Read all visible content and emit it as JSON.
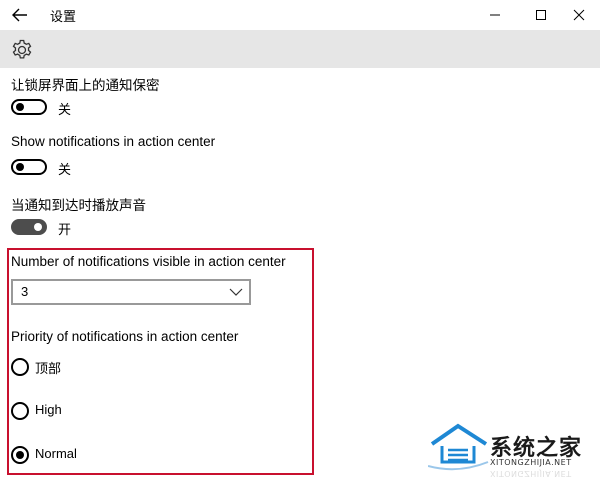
{
  "window": {
    "title": "设置"
  },
  "settings": {
    "lock_screen": {
      "label": "让锁屏界面上的通知保密",
      "state": "关",
      "on": false
    },
    "action_center": {
      "label": "Show notifications in action center",
      "state": "关",
      "on": false
    },
    "sound": {
      "label": "当通知到达时播放声音",
      "state": "开",
      "on": true
    },
    "visible_count": {
      "label": "Number of notifications visible in action center",
      "value": "3"
    },
    "priority": {
      "label": "Priority of notifications in action center",
      "options": [
        "顶部",
        "High",
        "Normal"
      ],
      "selected": "Normal"
    }
  },
  "watermark": {
    "text": "系统之家",
    "url": "XITONGZHIJIA.NET"
  },
  "colors": {
    "highlight_border": "#c8102e",
    "header_band": "#e6e6e6",
    "toggle_on": "#4d4d4d"
  }
}
